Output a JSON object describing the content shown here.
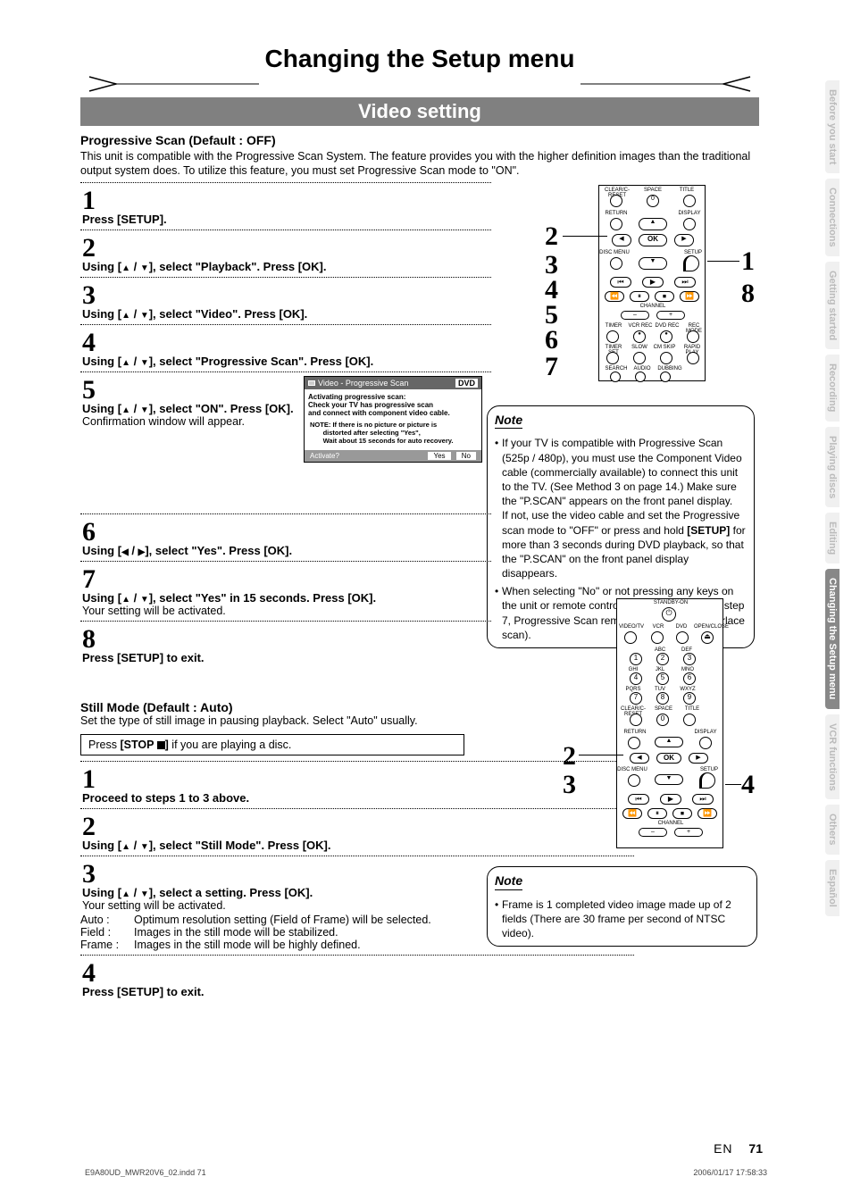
{
  "page": {
    "title": "Changing the Setup menu",
    "section": "Video setting",
    "lang": "EN",
    "num": "71",
    "src_file": "E9A80UD_MWR20V6_02.indd   71",
    "src_time": "2006/01/17   17:58:33"
  },
  "progressive": {
    "heading": "Progressive Scan (Default : OFF)",
    "intro": "This unit is compatible with the Progressive Scan System. The feature provides you with the higher definition images than the traditional output system does. To utilize this feature, you must set Progressive Scan mode to \"ON\".",
    "steps": {
      "s1": "Press [SETUP].",
      "s2a": "Using [",
      "s2b": "], select \"Playback\". Press [OK].",
      "s3a": "Using [",
      "s3b": "], select \"Video\". Press [OK].",
      "s4a": "Using [",
      "s4b": "], select \"Progressive Scan\". Press [OK].",
      "s5a": "Using [",
      "s5b": "], select \"ON\". Press [OK].",
      "s5c": "Confirmation window will appear.",
      "s6a": "Using [",
      "s6b": "], select \"Yes\". Press [OK].",
      "s7a": "Using [",
      "s7b": "], select \"Yes\" in 15 seconds. Press [OK].",
      "s7c": "Your setting will be activated.",
      "s8": "Press [SETUP] to exit."
    },
    "dialog": {
      "title": "Video - Progressive Scan",
      "tag": "DVD",
      "line1": "Activating progressive scan:",
      "line2": "Check your TV has progressive scan",
      "line3": "and connect with component video cable.",
      "noteLabel": "NOTE:",
      "note1": "If there is no picture or picture is",
      "note2": "distorted after selecting \"Yes\",",
      "note3": "Wait about 15 seconds for auto recovery.",
      "activate": "Activate?",
      "yes": "Yes",
      "no": "No"
    },
    "note": {
      "title": "Note",
      "b1a": "If your TV is compatible with Progressive Scan (525p / 480p), you must use the Component Video cable (commercially available) to connect this unit to the TV. (See Method 3 on page 14.) Make sure the \"P.SCAN\" appears on the front panel display.",
      "b1b": "If not, use the video cable and set the Progressive scan mode to \"OFF\" or press and hold ",
      "b1c": "[SETUP]",
      "b1d": " for more than 3 seconds during DVD playback, so that the \"P.SCAN\" on the front panel display disappears.",
      "b2": "When selecting \"No\" or not pressing any keys on the unit or remote control within 15 seconds at step 7, Progressive Scan remains to be \"OFF\" (interlace scan)."
    }
  },
  "still": {
    "heading": "Still Mode (Default : Auto)",
    "intro": "Set the type of still image in pausing playback. Select \"Auto\" usually.",
    "pre": "Press ",
    "preBold": "[STOP ",
    "post": "] ",
    "tail": "if you are playing a disc.",
    "steps": {
      "s1": "Proceed to steps 1 to 3 above.",
      "s2a": "Using [",
      "s2b": "], select \"Still Mode\". Press [OK].",
      "s3a": "Using [",
      "s3b": "], select a setting. Press [OK].",
      "s3c": "Your setting will be activated.",
      "s4": "Press [SETUP] to exit."
    },
    "options": {
      "auto": {
        "label": "Auto :",
        "text": "Optimum resolution setting (Field of Frame) will be selected."
      },
      "field": {
        "label": "Field :",
        "text": "Images in the still mode will be stabilized."
      },
      "frame": {
        "label": "Frame :",
        "text": "Images in the still mode will be highly defined."
      }
    },
    "note": {
      "title": "Note",
      "text": "Frame is 1 completed video image made up of 2 fields (There are 30 frame per second of NTSC video)."
    }
  },
  "remote_labels": {
    "top": {
      "clear": "CLEAR/C-RESET",
      "space": "SPACE",
      "title": "TITLE",
      "return": "RETURN",
      "display": "DISPLAY",
      "ok": "OK",
      "discmenu": "DISC MENU",
      "setup": "SETUP",
      "channel": "CHANNEL",
      "timer": "TIMER",
      "vcrrec": "VCR REC",
      "dvdrec": "DVD REC",
      "recmode": "REC MODE",
      "timerset": "TIMER SET",
      "slow": "SLOW",
      "cmskip": "CM SKIP",
      "rapid": "RAPID PLAY",
      "search": "SEARCH",
      "audio": "AUDIO",
      "dubbing": "DUBBING"
    },
    "bot": {
      "standby": "STANDBY-ON",
      "row1": {
        "a": "VIDEO/TV",
        "b": "VCR",
        "c": "DVD",
        "d": "OPEN/CLOSE"
      },
      "abc": "ABC",
      "def": "DEF",
      "ghi": "GHI",
      "jkl": "JKL",
      "mno": "MNO",
      "pqrs": "PQRS",
      "tuv": "TUV",
      "wxyz": "WXYZ",
      "clear": "CLEAR/C-RESET",
      "space": "SPACE",
      "title": "TITLE",
      "return": "RETURN",
      "display": "DISPLAY",
      "ok": "OK",
      "discmenu": "DISC MENU",
      "setup": "SETUP",
      "channel": "CHANNEL"
    }
  },
  "tabs": [
    {
      "label": "Before you start"
    },
    {
      "label": "Connections"
    },
    {
      "label": "Getting started"
    },
    {
      "label": "Recording"
    },
    {
      "label": "Playing discs"
    },
    {
      "label": "Editing"
    },
    {
      "label": "Changing the Setup menu"
    },
    {
      "label": "VCR functions"
    },
    {
      "label": "Others"
    },
    {
      "label": "Español"
    }
  ]
}
